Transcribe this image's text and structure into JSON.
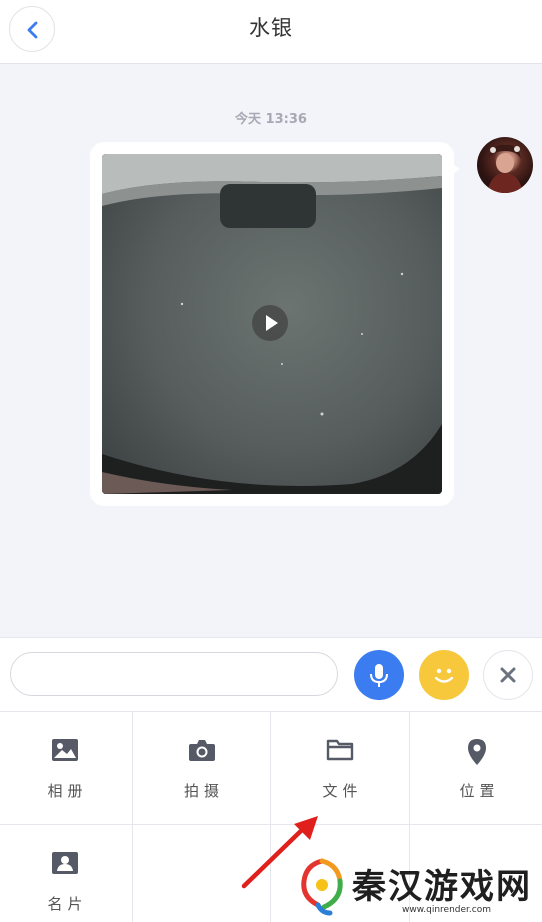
{
  "header": {
    "title": "水银",
    "back_icon": "chevron-left-icon"
  },
  "chat": {
    "timestamp": "今天 13:36",
    "message": {
      "type": "video",
      "play_icon": "play-icon"
    }
  },
  "input_bar": {
    "placeholder": "",
    "mic_icon": "microphone-icon",
    "emoji_icon": "smile-icon",
    "close_icon": "close-icon",
    "colors": {
      "mic": "#3b7cf0",
      "emoji": "#f7c83c"
    }
  },
  "panel": {
    "items": [
      {
        "label": "相册",
        "icon": "image-icon"
      },
      {
        "label": "拍摄",
        "icon": "camera-icon"
      },
      {
        "label": "文件",
        "icon": "folder-icon"
      },
      {
        "label": "位置",
        "icon": "location-pin-icon"
      },
      {
        "label": "名片",
        "icon": "contact-card-icon"
      }
    ]
  },
  "watermark": {
    "text": "秦汉游戏网",
    "url": "www.qinrender.com"
  }
}
